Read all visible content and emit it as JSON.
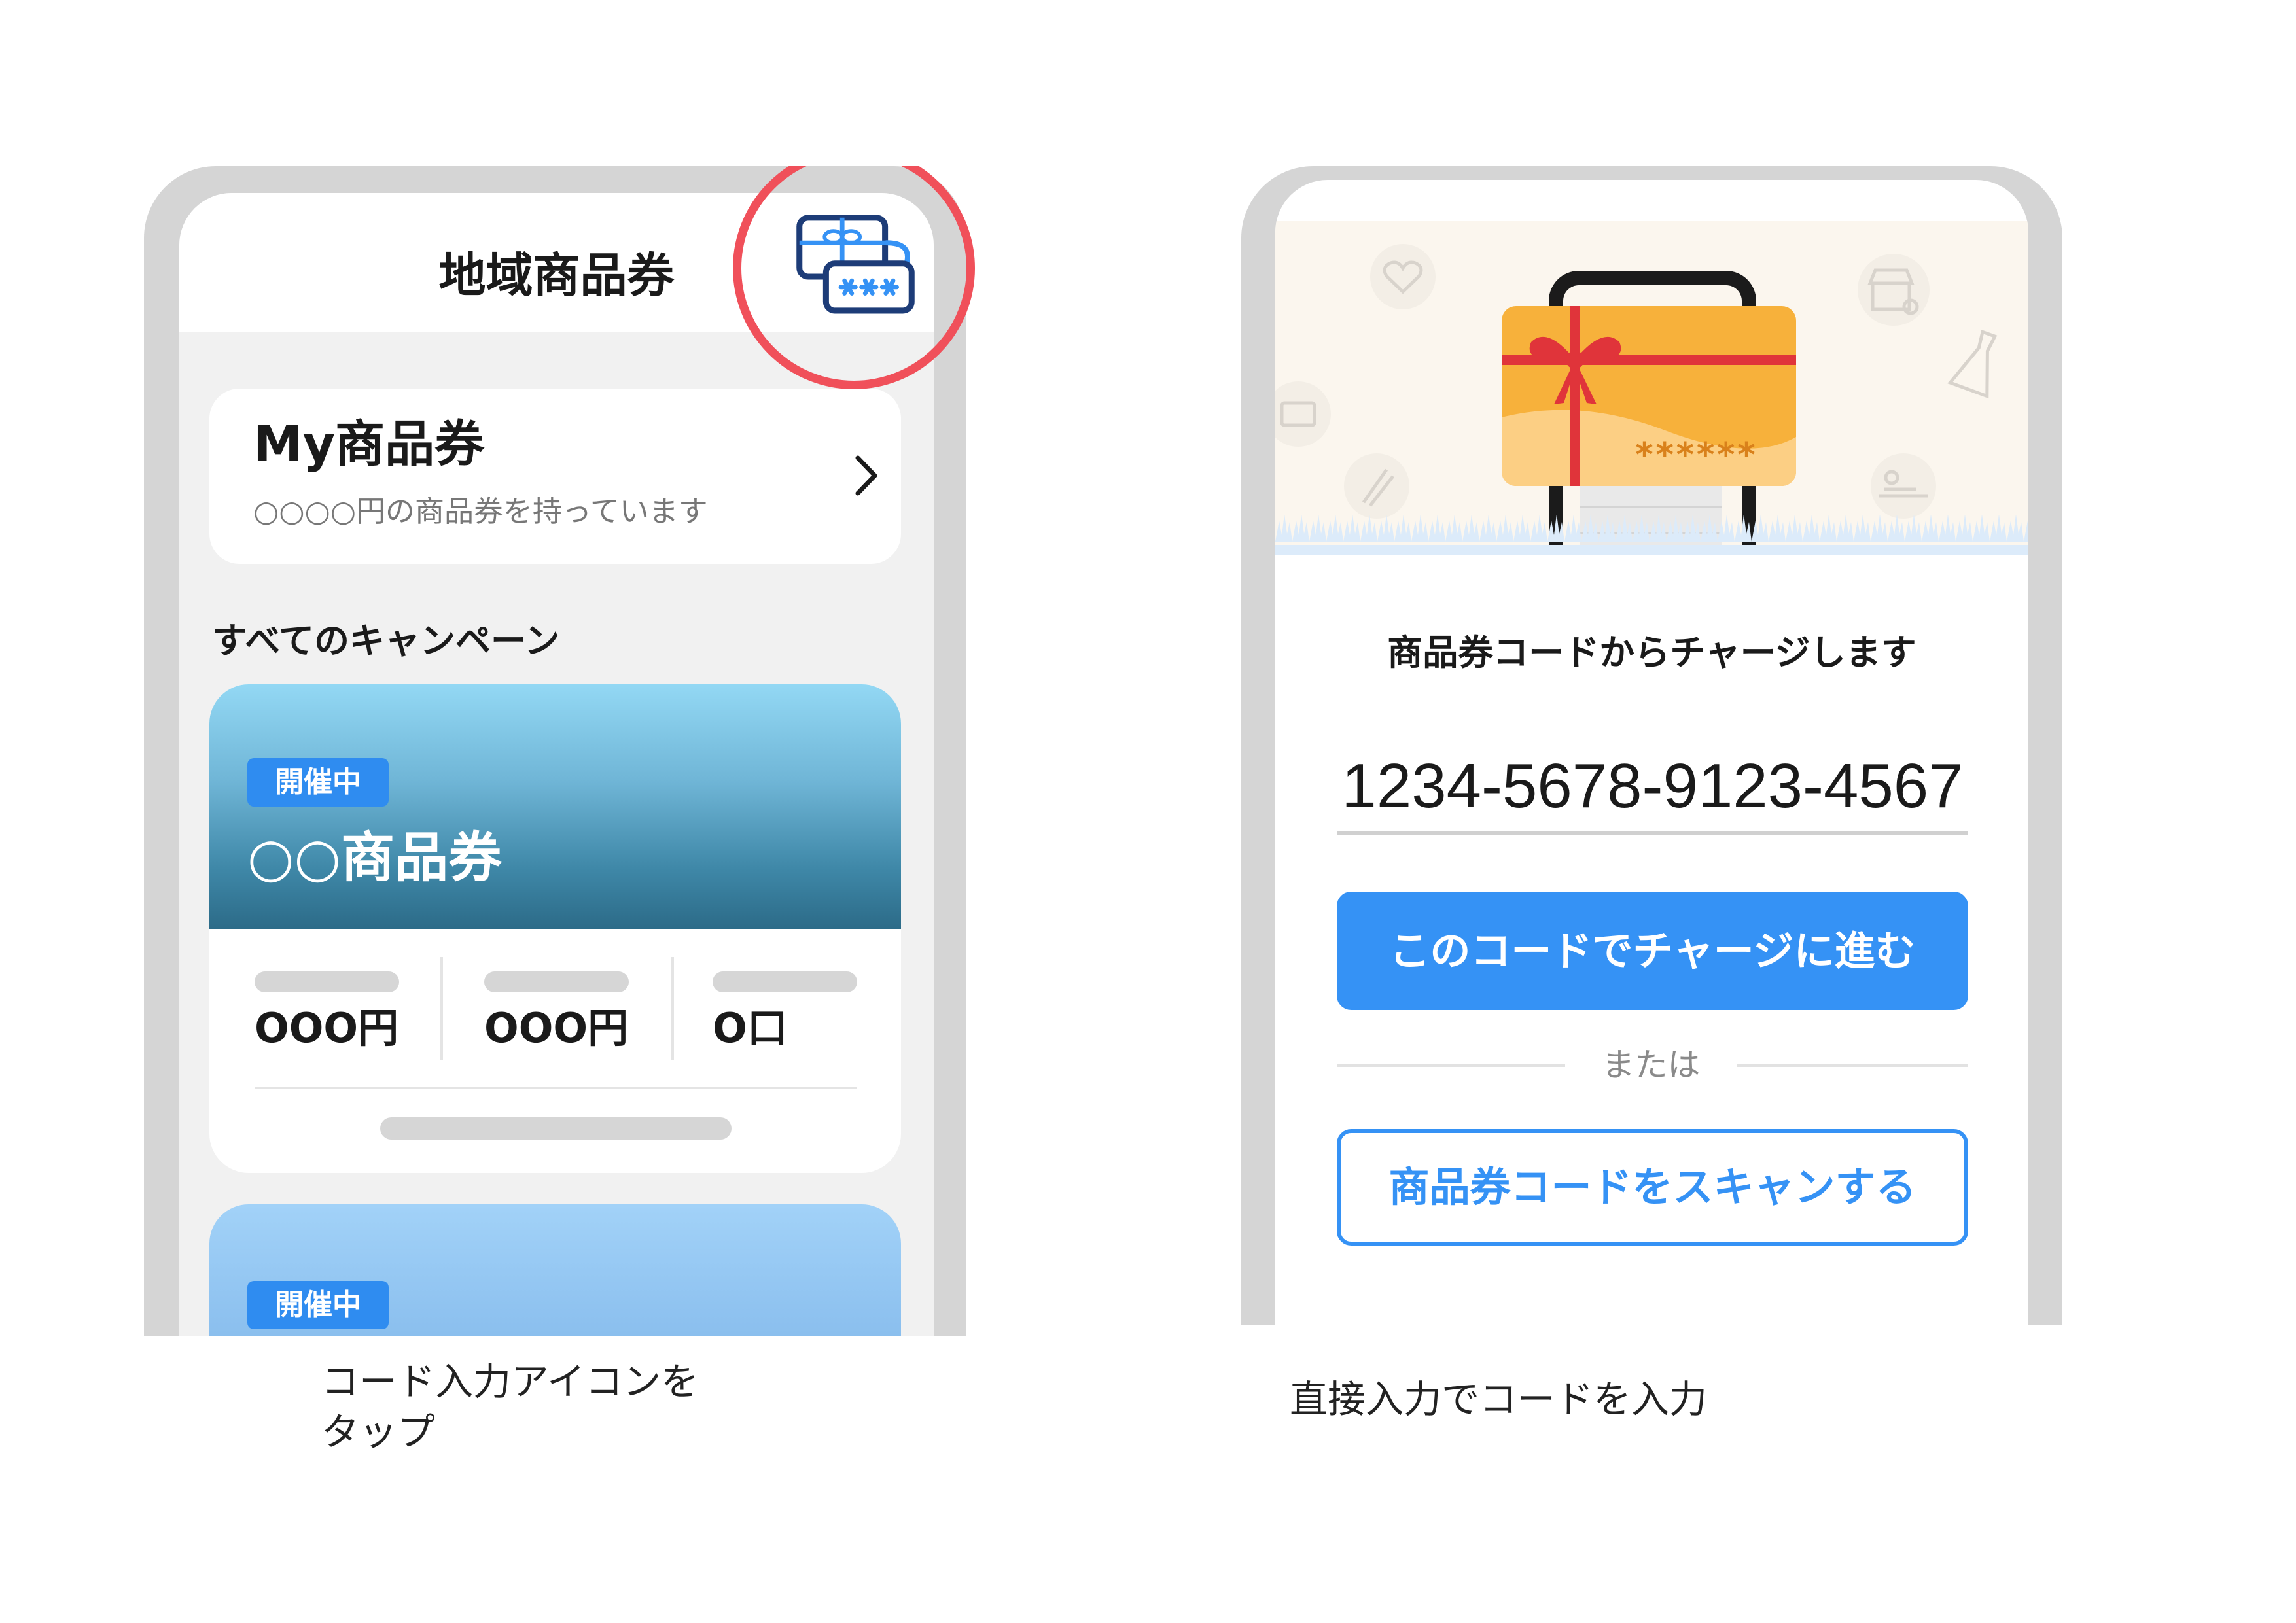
{
  "left_screen": {
    "header_title": "地域商品券",
    "code_input_icon": "gift-card-code-icon",
    "my_voucher": {
      "title": "My商品券",
      "subtitle": "○○○○円の商品券を持っています"
    },
    "section_title": "すべてのキャンペーン",
    "campaigns": [
      {
        "status": "開催中",
        "name": "○○商品券",
        "stats": [
          "OOO円",
          "OOO円",
          "O口"
        ]
      },
      {
        "status": "開催中"
      }
    ]
  },
  "left_caption": [
    "コード入力アイコンを",
    "タップ"
  ],
  "right_screen": {
    "card_mask": "******",
    "instruction": "商品券コードからチャージします",
    "code_value": "1234-5678-9123-4567",
    "charge_button": "このコードでチャージに進む",
    "divider_text": "または",
    "scan_button": "商品券コードをスキャンする"
  },
  "right_caption": "直接入力でコードを入力",
  "colors": {
    "accent": "#3592f5",
    "highlight_circle": "#f0505a",
    "badge": "#2f8cf0",
    "gift_card": "#f7b13b",
    "ribbon": "#e0343a"
  }
}
